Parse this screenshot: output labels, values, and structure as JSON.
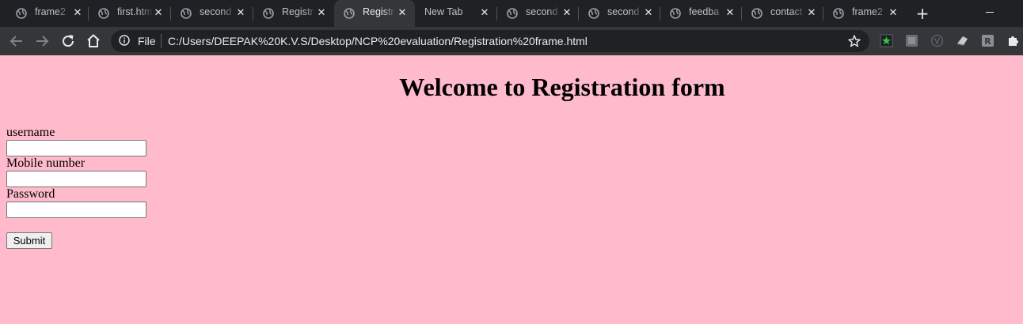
{
  "browser": {
    "tabs": [
      {
        "title": "frame2",
        "active": false
      },
      {
        "title": "first.htm",
        "active": false
      },
      {
        "title": "second",
        "active": false
      },
      {
        "title": "Registr",
        "active": false
      },
      {
        "title": "Registr",
        "active": true
      },
      {
        "title": "New Tab",
        "active": false
      },
      {
        "title": "second",
        "active": false
      },
      {
        "title": "second",
        "active": false
      },
      {
        "title": "feedba",
        "active": false
      },
      {
        "title": "contact",
        "active": false
      },
      {
        "title": "frame2",
        "active": false
      }
    ],
    "close_glyph": "✕",
    "new_tab_glyph": "+",
    "address_bar": {
      "scheme_label": "File",
      "url": "C:/Users/DEEPAK%20K.V.S/Desktop/NCP%20evaluation/Registration%20frame.html"
    },
    "icons": {
      "back": "arrow-left-icon",
      "forward": "arrow-right-icon",
      "reload": "reload-icon",
      "home": "home-icon",
      "info": "info-icon",
      "bookmark": "star-icon",
      "extensions": "puzzle-icon"
    }
  },
  "page": {
    "title": "Welcome to Registration form",
    "background_color": "#ffbbcb",
    "form": {
      "username_label": "username",
      "username_value": "",
      "mobile_label": "Mobile number",
      "mobile_value": "",
      "password_label": "Password",
      "password_value": "",
      "submit_label": "Submit"
    }
  }
}
